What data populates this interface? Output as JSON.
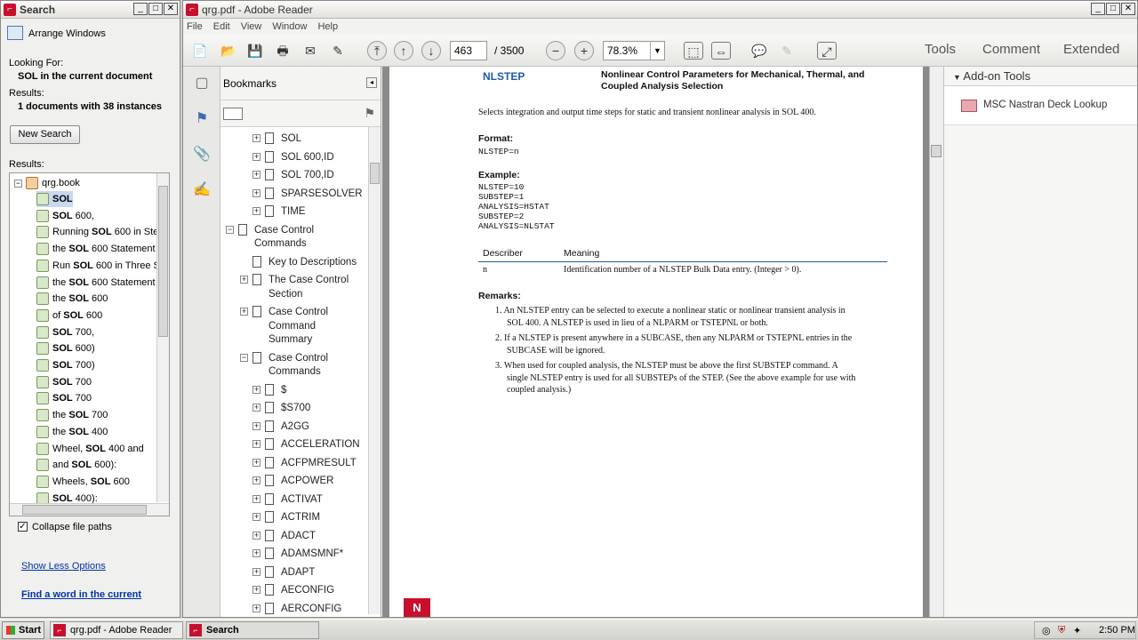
{
  "search": {
    "title": "Search",
    "arrange": "Arrange Windows",
    "looking_for_label": "Looking For:",
    "looking_for": "SOL in the current document",
    "results_label": "Results:",
    "results_summary": "1 documents with 38 instances",
    "new_search": "New Search",
    "results_label2": "Results:",
    "book": "qrg.book",
    "results": [
      {
        "pre": "",
        "kw": "SOL",
        "post": ""
      },
      {
        "pre": "",
        "kw": "SOL",
        "post": " 600,"
      },
      {
        "pre": "Running ",
        "kw": "SOL",
        "post": " 600 in Ste"
      },
      {
        "pre": "the ",
        "kw": "SOL",
        "post": " 600 Statement"
      },
      {
        "pre": "Run ",
        "kw": "SOL",
        "post": " 600 in Three S"
      },
      {
        "pre": "the ",
        "kw": "SOL",
        "post": " 600 Statement"
      },
      {
        "pre": "the ",
        "kw": "SOL",
        "post": " 600"
      },
      {
        "pre": "of ",
        "kw": "SOL",
        "post": " 600"
      },
      {
        "pre": "",
        "kw": "SOL",
        "post": " 700,"
      },
      {
        "pre": "",
        "kw": "SOL",
        "post": " 600)"
      },
      {
        "pre": "",
        "kw": "SOL",
        "post": " 700)"
      },
      {
        "pre": "",
        "kw": "SOL",
        "post": " 700"
      },
      {
        "pre": "",
        "kw": "SOL",
        "post": " 700"
      },
      {
        "pre": "the ",
        "kw": "SOL",
        "post": " 700"
      },
      {
        "pre": "the ",
        "kw": "SOL",
        "post": " 400"
      },
      {
        "pre": "Wheel, ",
        "kw": "SOL",
        "post": " 400 and"
      },
      {
        "pre": "and ",
        "kw": "SOL",
        "post": " 600):"
      },
      {
        "pre": "Wheels, ",
        "kw": "SOL",
        "post": " 600"
      },
      {
        "pre": "",
        "kw": "SOL",
        "post": " 400):"
      }
    ],
    "collapse": "Collapse file paths",
    "show_less": "Show Less Options",
    "find_word": "Find a word in the current"
  },
  "reader": {
    "title": "qrg.pdf - Adobe Reader",
    "menu": [
      "File",
      "Edit",
      "View",
      "Window",
      "Help"
    ],
    "page_current": "463",
    "page_total": "/ 3500",
    "zoom": "78.3%",
    "links": [
      "Tools",
      "Comment",
      "Extended"
    ],
    "bookmarks_title": "Bookmarks",
    "bookmarks": [
      {
        "label": "SOL",
        "lvl": 2
      },
      {
        "label": "SOL 600,ID",
        "lvl": 2
      },
      {
        "label": "SOL 700,ID",
        "lvl": 2
      },
      {
        "label": "SPARSESOLVER",
        "lvl": 2
      },
      {
        "label": "TIME",
        "lvl": 2
      },
      {
        "label": "Case Control",
        "lvl": 0,
        "exp": "−"
      },
      {
        "label": "Commands",
        "lvl": 0,
        "cont": true
      },
      {
        "label": "Key to Descriptions",
        "lvl": 1,
        "noexp": true
      },
      {
        "label": "The Case Control",
        "lvl": 1
      },
      {
        "label": "Section",
        "lvl": 1,
        "cont": true
      },
      {
        "label": "Case Control",
        "lvl": 1
      },
      {
        "label": "Command",
        "lvl": 1,
        "cont": true
      },
      {
        "label": "Summary",
        "lvl": 1,
        "cont": true
      },
      {
        "label": "Case Control",
        "lvl": 1,
        "exp": "−"
      },
      {
        "label": "Commands",
        "lvl": 1,
        "cont": true
      },
      {
        "label": "$",
        "lvl": 2
      },
      {
        "label": "$S700",
        "lvl": 2
      },
      {
        "label": "A2GG",
        "lvl": 2
      },
      {
        "label": "ACCELERATION",
        "lvl": 2
      },
      {
        "label": "ACFPMRESULT",
        "lvl": 2
      },
      {
        "label": "ACPOWER",
        "lvl": 2
      },
      {
        "label": "ACTIVAT",
        "lvl": 2
      },
      {
        "label": "ACTRIM",
        "lvl": 2
      },
      {
        "label": "ADACT",
        "lvl": 2
      },
      {
        "label": "ADAMSMNF*",
        "lvl": 2
      },
      {
        "label": "ADAPT",
        "lvl": 2
      },
      {
        "label": "AECONFIG",
        "lvl": 2
      },
      {
        "label": "AERCONFIG",
        "lvl": 2
      }
    ],
    "addon_title": "Add-on Tools",
    "addon_item": "MSC Nastran Deck Lookup"
  },
  "doc": {
    "heading": "NLSTEP",
    "subtitle1": "Nonlinear Control Parameters for Mechanical, Thermal, and",
    "subtitle2": "Coupled Analysis Selection",
    "intro": "Selects integration and output time steps for static and transient nonlinear analysis in SOL 400.",
    "format_label": "Format:",
    "format": "NLSTEP=n",
    "example_label": "Example:",
    "example": [
      "NLSTEP=10",
      "SUBSTEP=1",
      "ANALYSIS=HSTAT",
      "SUBSTEP=2",
      "ANALYSIS=NLSTAT"
    ],
    "col1": "Describer",
    "col2": "Meaning",
    "row_d": "n",
    "row_m": "Identification number of a NLSTEP Bulk Data entry. (Integer > 0).",
    "remarks_label": "Remarks:",
    "r1a": "1.  An NLSTEP entry can be selected to execute a nonlinear static or nonlinear transient analysis in",
    "r1b": "SOL 400. A NLSTEP is used in lieu of a NLPARM or TSTEPNL or both.",
    "r2a": "2.  If a NLSTEP is present anywhere in a SUBCASE, then any NLPARM or TSTEPNL entries in the",
    "r2b": "SUBCASE will be ignored.",
    "r3a": "3.  When used for coupled analysis, the NLSTEP must be above the first SUBSTEP command. A",
    "r3b": "single NLSTEP entry is used for all SUBSTEPs of the STEP. (See the above example for use with",
    "r3c": "coupled analysis.)",
    "badge": "N"
  },
  "taskbar": {
    "start": "Start",
    "items": [
      "qrg.pdf - Adobe Reader",
      "Search"
    ],
    "time": "2:50 PM"
  }
}
